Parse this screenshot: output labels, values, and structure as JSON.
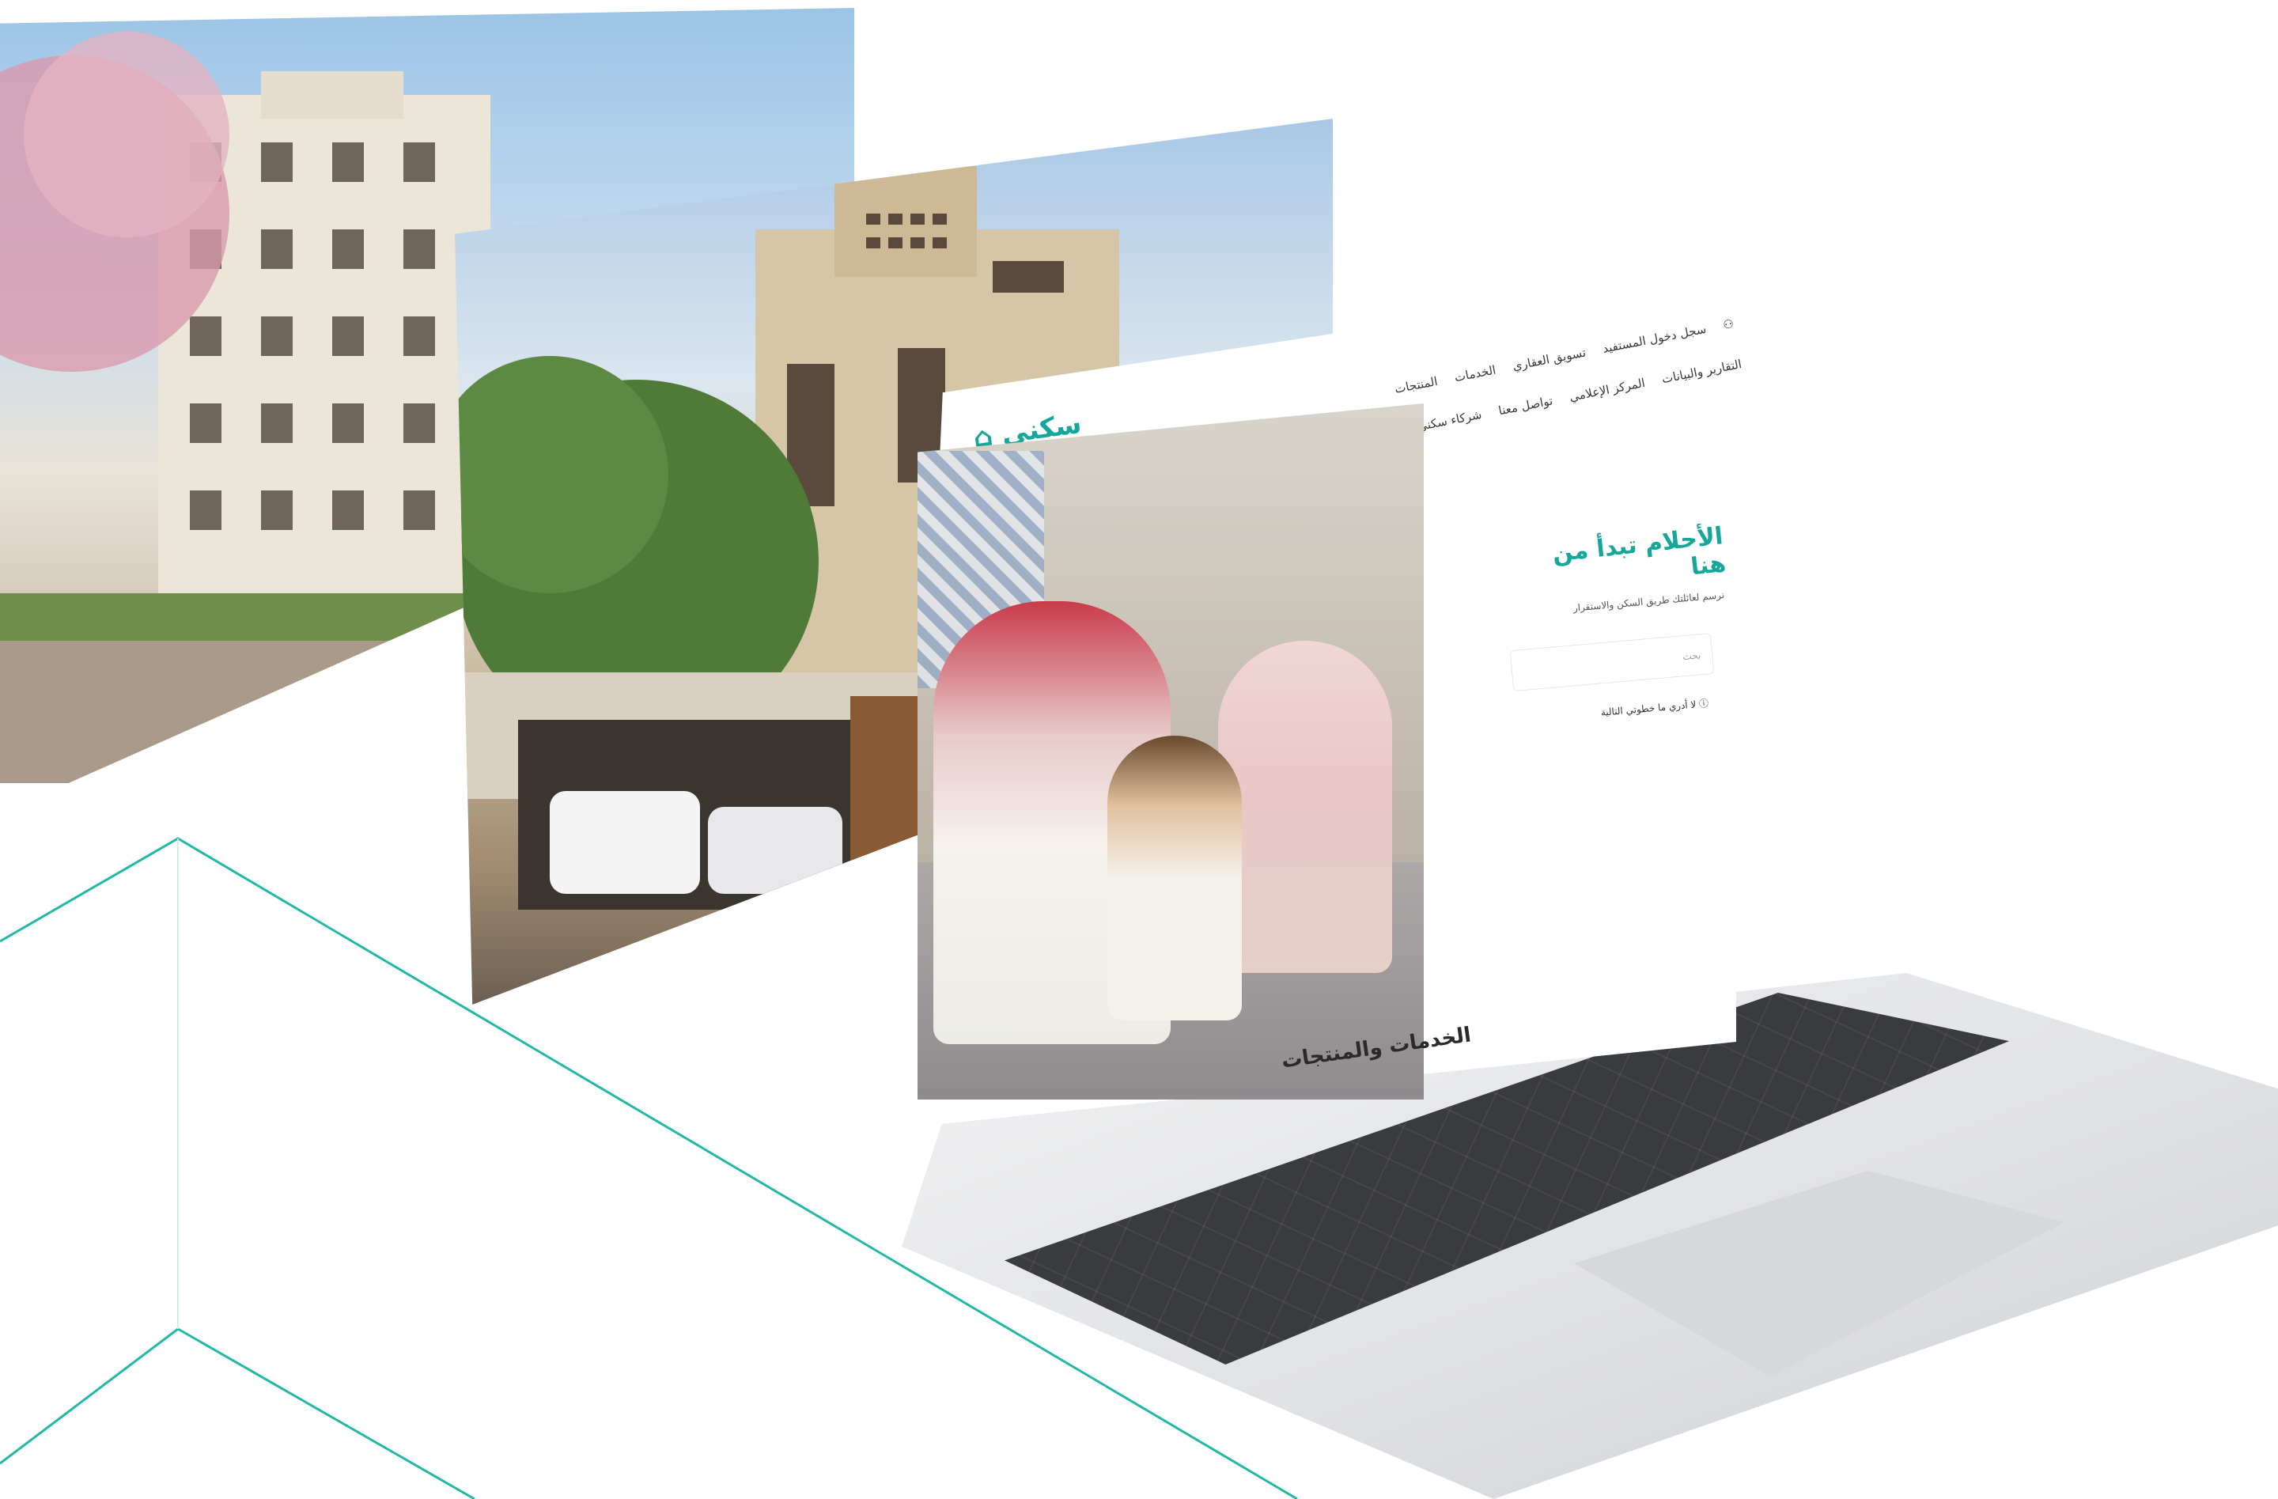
{
  "website": {
    "logo_text": "سكني",
    "nav_row1": [
      "سجل دخول المستفيد",
      "تسويق العقاري",
      "الخدمات",
      "المنتجات"
    ],
    "nav_row2": [
      "التقارير والبيانات",
      "المركز الإعلامي",
      "تواصل معنا",
      "شركاء سكني"
    ],
    "hero_title": "الأحلام تبدأ من هنا",
    "hero_subtitle": "نرسم لعائلتك طريق السكن والاستقرار",
    "search_placeholder": "بحث",
    "hero_link": "لا أدري ما خطوتي التالية",
    "section_heading": "الخدمات والمنتجات"
  },
  "colors": {
    "accent_teal": "#17a79a",
    "line_teal": "#22b8a8",
    "laptop_body": "#e9e9ea",
    "keyboard": "#3a3b3f"
  },
  "icons": [
    "user-icon",
    "home-logo-icon",
    "help-icon"
  ]
}
